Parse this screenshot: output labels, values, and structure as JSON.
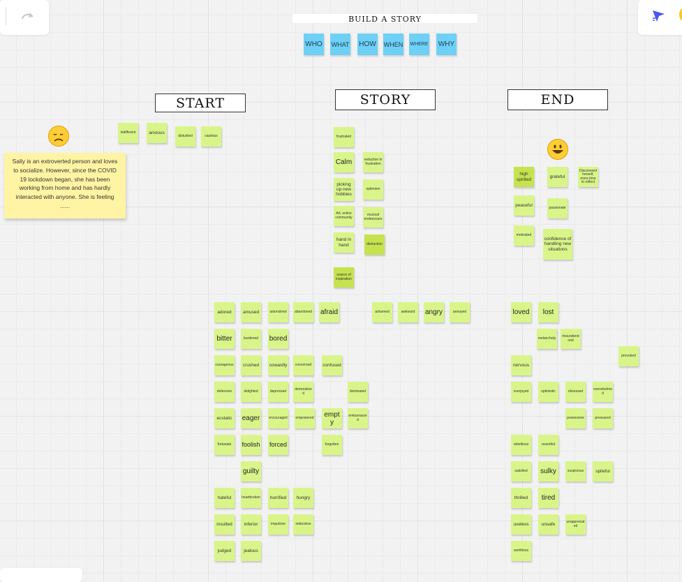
{
  "colors": {
    "sticky": "#d9f58a",
    "sticky_dark": "#c6e34f",
    "question": "#6fd0f6",
    "note": "#fff4a3"
  },
  "toolbar": {
    "redo_icon": "redo-arrow-icon",
    "reactions_icon": "cursor-arrow-icon"
  },
  "board": {
    "title": "BUILD A STORY",
    "questions": [
      "WHO",
      "WHAT",
      "HOW",
      "WHEN",
      "WHERE",
      "WHY"
    ],
    "columns": {
      "start": "START",
      "story": "STORY",
      "end": "END"
    },
    "note": "Sally is an extroverted person and loves to socialize. However, since the COVID 19 lockdown began, she has been working from home and has hardly interacted with anyone. She is feeling ......",
    "start_stickies": [
      "indifferent",
      "anxious",
      "disturbed",
      "cautious"
    ],
    "story_stickies": [
      "frustrated",
      "Calm",
      "reduction in frustration",
      "picking up new hobbies",
      "optimism",
      "Art, online community",
      "musical endeavours",
      "hand in hand",
      "distraction",
      "source of inspiration"
    ],
    "end_stickies": [
      "high spirited",
      "grateful",
      "Discovered herself, more time to reflect",
      "peaceful",
      "passionate",
      "motivated",
      "confidence of handling new situations"
    ],
    "bank_left": [
      "adored",
      "amused",
      "astonished",
      "abandoned",
      "afraid",
      "ashamed",
      "awkward",
      "angry",
      "annoyed",
      "bitter",
      "burdened",
      "bored",
      "courageous",
      "crushed",
      "cowardly",
      "concerned",
      "confused",
      "defensive",
      "delighted",
      "depressed",
      "demoralized",
      "dominated",
      "ecstatic",
      "eager",
      "encouraged",
      "empowered",
      "empty",
      "embarrassed",
      "fortunate",
      "foolish",
      "forced",
      "forgotten",
      "guilty",
      "hateful",
      "heartbroken",
      "horrified",
      "hungry",
      "insulted",
      "inferior",
      "impulsive",
      "indecisive",
      "judged",
      "jealous"
    ],
    "bank_right": [
      "loved",
      "lost",
      "melancholy",
      "misunderstood",
      "provoked",
      "nervous",
      "overjoyed",
      "optimistic",
      "obsessed",
      "overwhelmed",
      "possessive",
      "pressured",
      "rebellious",
      "resentful",
      "satisfied",
      "sulky",
      "suspicious",
      "spiteful",
      "thrilled",
      "tired",
      "useless",
      "unsafe",
      "unappreciated",
      "worthless"
    ]
  }
}
